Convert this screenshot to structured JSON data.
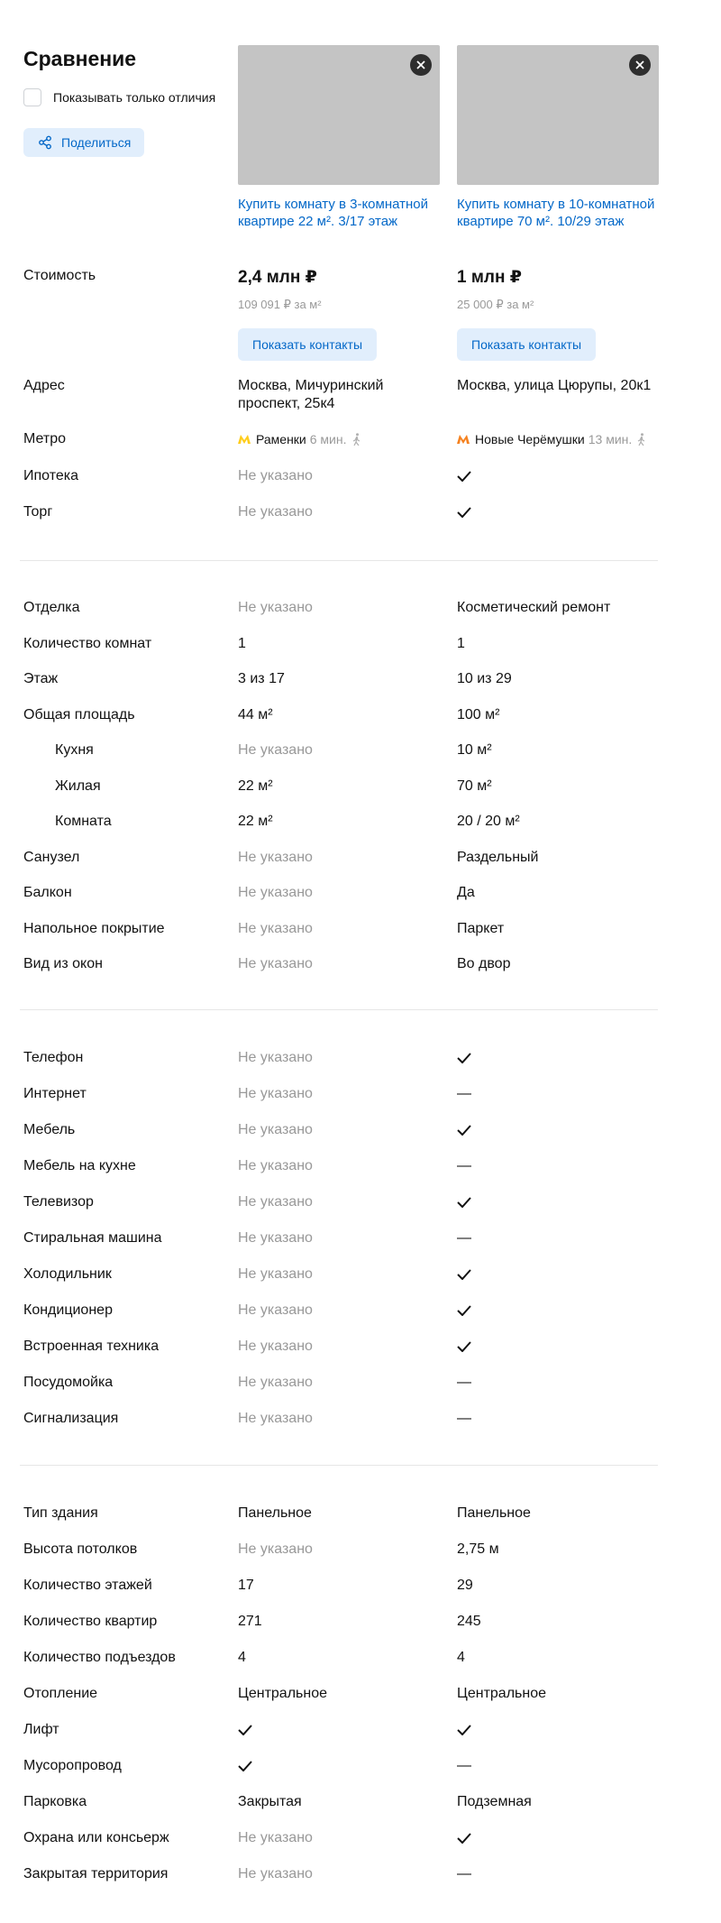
{
  "header": {
    "title": "Сравнение",
    "diff_only_label": "Показывать только отличия",
    "share_label": "Поделиться"
  },
  "cards": [
    {
      "link": "Купить комнату в 3-комнатной квартире 22 м². 3/17 этаж"
    },
    {
      "link": "Купить комнату в 10-комнатной квартире 70 м². 10/29 этаж"
    }
  ],
  "price": {
    "label": "Стоимость",
    "values": [
      "2,4 млн ₽",
      "1 млн ₽"
    ],
    "per_m2": [
      "109 091 ₽ за м²",
      "25 000 ₽ за м²"
    ],
    "contacts_label": "Показать контакты"
  },
  "address": {
    "label": "Адрес",
    "values": [
      "Москва, Мичуринский проспект, 25к4",
      "Москва, улица Цюрупы, 20к1"
    ]
  },
  "metro": {
    "label": "Метро",
    "stations": [
      {
        "name": "Раменки",
        "walk": "6 мин.",
        "color": "#ffcd1c"
      },
      {
        "name": "Новые Черёмушки",
        "walk": "13 мин.",
        "color": "#f58220"
      }
    ]
  },
  "mortgage": {
    "label": "Ипотека",
    "values": [
      "Не указано",
      "check"
    ]
  },
  "bargain": {
    "label": "Торг",
    "values": [
      "Не указано",
      "check"
    ]
  },
  "flat": [
    {
      "label": "Отделка",
      "v1": "Не указано",
      "v2": "Косметический ремонт"
    },
    {
      "label": "Количество комнат",
      "v1": "1",
      "v2": "1"
    },
    {
      "label": "Этаж",
      "v1": "3 из 17",
      "v2": "10 из 29"
    },
    {
      "label": "Общая площадь",
      "v1": "44 м²",
      "v2": "100 м²"
    },
    {
      "label": "Кухня",
      "v1": "Не указано",
      "v2": "10 м²"
    },
    {
      "label": "Жилая",
      "v1": "22 м²",
      "v2": "70 м²"
    },
    {
      "label": "Комната",
      "v1": "22 м²",
      "v2": "20 / 20 м²"
    },
    {
      "label": "Санузел",
      "v1": "Не указано",
      "v2": "Раздельный"
    },
    {
      "label": "Балкон",
      "v1": "Не указано",
      "v2": "Да"
    },
    {
      "label": "Напольное покрытие",
      "v1": "Не указано",
      "v2": "Паркет"
    },
    {
      "label": "Вид из окон",
      "v1": "Не указано",
      "v2": "Во двор"
    }
  ],
  "amenities": [
    {
      "label": "Телефон",
      "v1": "Не указано",
      "v2": "check"
    },
    {
      "label": "Интернет",
      "v1": "Не указано",
      "v2": "—"
    },
    {
      "label": "Мебель",
      "v1": "Не указано",
      "v2": "check"
    },
    {
      "label": "Мебель на кухне",
      "v1": "Не указано",
      "v2": "—"
    },
    {
      "label": "Телевизор",
      "v1": "Не указано",
      "v2": "check"
    },
    {
      "label": "Стиральная машина",
      "v1": "Не указано",
      "v2": "—"
    },
    {
      "label": "Холодильник",
      "v1": "Не указано",
      "v2": "check"
    },
    {
      "label": "Кондиционер",
      "v1": "Не указано",
      "v2": "check"
    },
    {
      "label": "Встроенная техника",
      "v1": "Не указано",
      "v2": "check"
    },
    {
      "label": "Посудомойка",
      "v1": "Не указано",
      "v2": "—"
    },
    {
      "label": "Сигнализация",
      "v1": "Не указано",
      "v2": "—"
    }
  ],
  "building": [
    {
      "label": "Тип здания",
      "v1": "Панельное",
      "v2": "Панельное"
    },
    {
      "label": "Высота потолков",
      "v1": "Не указано",
      "v2": "2,75 м"
    },
    {
      "label": "Количество этажей",
      "v1": "17",
      "v2": "29"
    },
    {
      "label": "Количество квартир",
      "v1": "271",
      "v2": "245"
    },
    {
      "label": "Количество подъездов",
      "v1": "4",
      "v2": "4"
    },
    {
      "label": "Отопление",
      "v1": "Центральное",
      "v2": "Центральное"
    },
    {
      "label": "Лифт",
      "v1": "check",
      "v2": "check"
    },
    {
      "label": "Мусоропровод",
      "v1": "check",
      "v2": "—"
    },
    {
      "label": "Парковка",
      "v1": "Закрытая",
      "v2": "Подземная"
    },
    {
      "label": "Охрана или консьерж",
      "v1": "Не указано",
      "v2": "check"
    },
    {
      "label": "Закрытая территория",
      "v1": "Не указано",
      "v2": "—"
    }
  ]
}
